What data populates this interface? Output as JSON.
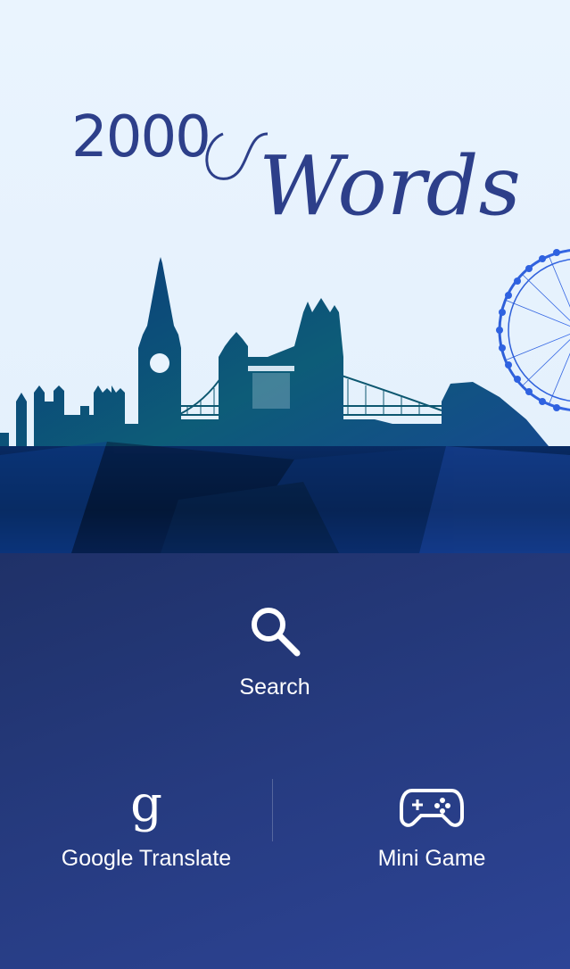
{
  "logo": {
    "number": "2000",
    "script": "Words"
  },
  "menu": {
    "search": {
      "label": "Search",
      "icon": "search-icon"
    },
    "translate": {
      "label": "Google Translate",
      "icon": "google-g-icon",
      "glyph": "g"
    },
    "game": {
      "label": "Mini Game",
      "icon": "gamepad-icon"
    }
  },
  "colors": {
    "brand": "#2d3f8a",
    "menu_bg_start": "#1f3168",
    "menu_bg_end": "#2d4496",
    "sky": "#e8f3fd"
  }
}
